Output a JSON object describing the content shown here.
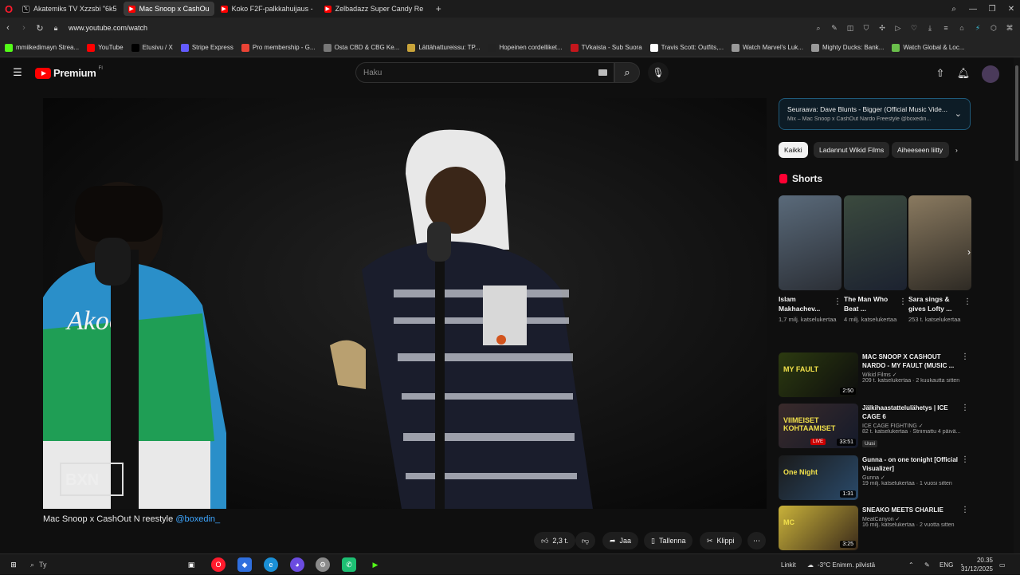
{
  "browser": {
    "tabs": [
      {
        "label": "Akatemiks TV Xzzsbi \"6k5",
        "icon": "x-icon",
        "active": false
      },
      {
        "label": "Mac Snoop x CashOu",
        "icon": "youtube-icon",
        "active": true
      },
      {
        "label": "Koko F2F-palkkahuijaus -",
        "icon": "youtube-icon",
        "active": false
      },
      {
        "label": "Zelbadazz Super Candy Re",
        "icon": "youtube-icon",
        "active": false
      }
    ],
    "url": "www.youtube.com/watch",
    "bookmarks": [
      {
        "label": "mmiikedimayn Strea...",
        "icon": "kick-icon",
        "color": "#53fc18"
      },
      {
        "label": "YouTube",
        "icon": "youtube-icon",
        "color": "#ff0000"
      },
      {
        "label": "Etusivu / X",
        "icon": "x-icon",
        "color": "#000000"
      },
      {
        "label": "Stripe Express",
        "icon": "stripe-icon",
        "color": "#635bff"
      },
      {
        "label": "Pro membership - G...",
        "icon": "map-pin-icon",
        "color": "#ea4335"
      },
      {
        "label": "Osta CBD & CBG Ke...",
        "icon": "globe-icon",
        "color": "#777777"
      },
      {
        "label": "Lättähattureissu: TP...",
        "icon": "hat-icon",
        "color": "#c9a43a"
      },
      {
        "label": "Hopeinen cordelliket...",
        "icon": "nt-icon",
        "color": "#222222"
      },
      {
        "label": "TVkaista - Sub Suora",
        "icon": "tv-icon",
        "color": "#c4161c"
      },
      {
        "label": "Travis Scott: Outfits,...",
        "icon": "w-icon",
        "color": "#ffffff"
      },
      {
        "label": "Watch Marvel's Luk...",
        "icon": "link-icon",
        "color": "#999999"
      },
      {
        "label": "Mighty Ducks: Bank...",
        "icon": "bolt-icon",
        "color": "#999999"
      },
      {
        "label": "Watch Global & Loc...",
        "icon": "globe-icon",
        "color": "#6abf4b"
      }
    ]
  },
  "youtube": {
    "brand": "Premium",
    "region": "FI",
    "search_placeholder": "Haku",
    "video": {
      "title_prefix": "Mac Snoop x CashOut N",
      "title_mid": "  reestyle ",
      "title_link": "@boxedin_",
      "watermark": "BXN"
    },
    "actions": {
      "likes": "2,3 t.",
      "share": "Jaa",
      "save": "Tallenna",
      "clip": "Klippi"
    },
    "next_up": {
      "title": "Seuraava: Dave Blunts - Bigger (Official Music Vide...",
      "subtitle": "Mix – Mac Snoop x CashOut Nardo Freestyle @boxedin..."
    },
    "chips": [
      "Kaikki",
      "Ladannut Wikid Films",
      "Aiheeseen liitty"
    ],
    "shorts_label": "Shorts",
    "shorts": [
      {
        "title": "Islam Makhachev...",
        "views": "1,7 milj. katselukertaa"
      },
      {
        "title": "The Man Who Beat ...",
        "views": "4 milj. katselukertaa"
      },
      {
        "title": "Sara sings & gives Lofty ...",
        "views": "253 t. katselukertaa"
      }
    ],
    "recommendations": [
      {
        "title": "MAC SNOOP X CASHOUT NARDO - MY FAULT (MUSIC ...",
        "channel": "Wikid Films",
        "meta": "209 t. katselukertaa · 2 kuukautta sitten",
        "duration": "2:50",
        "thumb_text": "MY FAULT"
      },
      {
        "title": "Jälkihaastattelulähetys | ICE CAGE 6",
        "channel": "ICE CAGE FIGHTING",
        "meta": "82 t. katselukertaa · Striimattu 4 päivä...",
        "badge": "Uusi",
        "duration": "33:51",
        "thumb_text": "VIIMEISET KOHTAAMISET",
        "live": "LIVE"
      },
      {
        "title": "Gunna - on one tonight [Official Visualizer]",
        "channel": "Gunna",
        "meta": "19 milj. katselukertaa · 1 vuosi sitten",
        "duration": "1:31",
        "thumb_text": "One Night"
      },
      {
        "title": "SNEAKO MEETS CHARLIE",
        "channel": "MeatCanyon",
        "meta": "16 milj. katselukertaa · 2 vuotta sitten",
        "duration": "3:25",
        "thumb_text": "MC"
      }
    ]
  },
  "taskbar": {
    "search": "Ty",
    "links": "Linkit",
    "weather": "-3°C  Enimm. pilvistä",
    "lang": "ENG",
    "time": "20.35",
    "date": "31/12/2025"
  }
}
